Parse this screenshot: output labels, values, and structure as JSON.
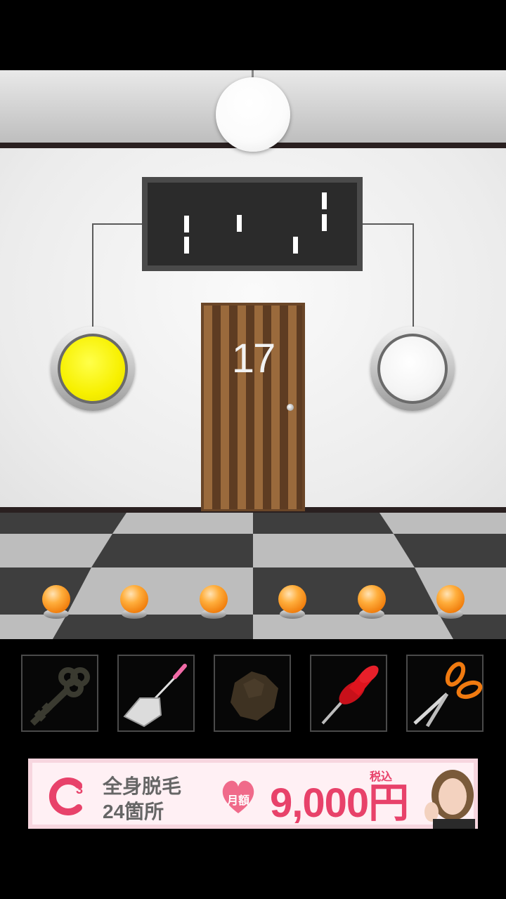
{
  "room": {
    "door_number": "17",
    "left_light_state": "yellow",
    "right_light_state": "white",
    "floor_button_count": 6
  },
  "inventory": {
    "items": [
      {
        "name": "key"
      },
      {
        "name": "shovel"
      },
      {
        "name": "rock"
      },
      {
        "name": "pushpin"
      },
      {
        "name": "scissors"
      }
    ]
  },
  "ad": {
    "line1": "全身脱毛",
    "line2": "24箇所",
    "heart_text": "月額",
    "price": "9,000円",
    "tax": "税込"
  },
  "colors": {
    "light_yellow": "#f7f000",
    "button_orange": "#f07d0c",
    "ad_pink": "#e8426a"
  }
}
